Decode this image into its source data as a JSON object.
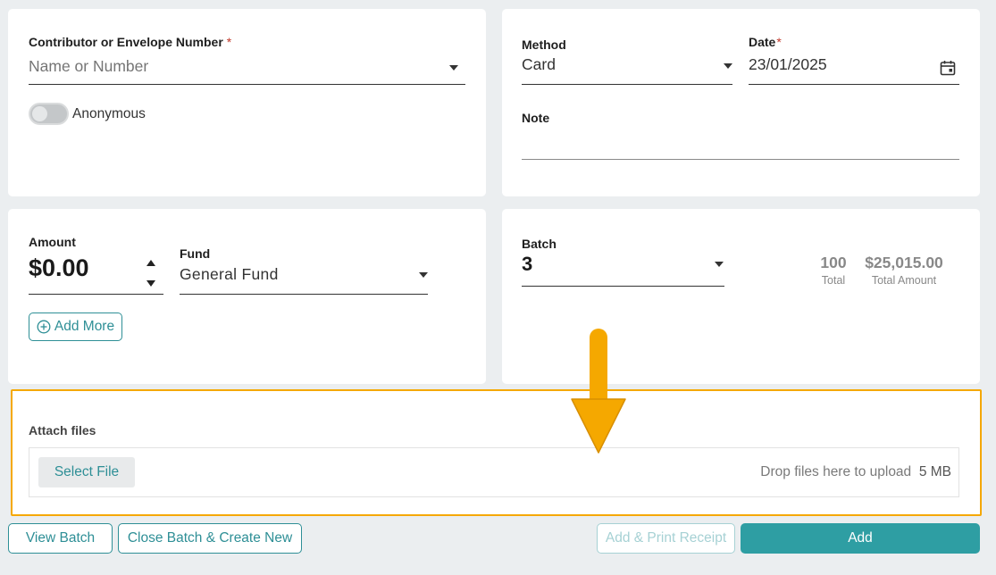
{
  "contributor": {
    "label": "Contributor or Envelope Number",
    "required_mark": "*",
    "placeholder": "Name or Number"
  },
  "anonymous": {
    "label": "Anonymous",
    "on": false
  },
  "method": {
    "label": "Method",
    "value": "Card"
  },
  "date": {
    "label": "Date",
    "required_mark": "*",
    "value": "23/01/2025"
  },
  "note": {
    "label": "Note",
    "value": ""
  },
  "amount": {
    "label": "Amount",
    "value": "$0.00"
  },
  "fund": {
    "label": "Fund",
    "value": "General Fund"
  },
  "add_more": {
    "label": "Add More"
  },
  "batch": {
    "label": "Batch",
    "value": "3",
    "total_count": "100",
    "total_count_label": "Total",
    "total_amount": "$25,015.00",
    "total_amount_label": "Total Amount"
  },
  "attach": {
    "label": "Attach files",
    "select_file": "Select File",
    "drop_text": "Drop files here to upload",
    "max_size": "5 MB"
  },
  "footer": {
    "view_batch": "View Batch",
    "close_batch": "Close Batch & Create New",
    "add_print": "Add & Print Receipt",
    "add": "Add"
  },
  "colors": {
    "accent": "#2e9ea3",
    "highlight": "#f5a800",
    "required": "#c0392b"
  },
  "icons": [
    "calendar-icon",
    "plus-circle-icon",
    "chevron-down-icon",
    "arrow-down-icon"
  ]
}
